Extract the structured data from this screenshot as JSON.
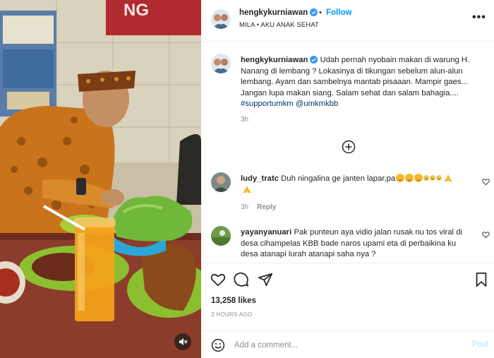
{
  "media": {
    "banner_text": "NG",
    "mute_icon": "speaker-muted-icon"
  },
  "header": {
    "username": "hengkykurniawan",
    "dot": "•",
    "follow_label": "Follow",
    "audio": "MILA • AKU ANAK SEHAT",
    "more": "•••"
  },
  "caption": {
    "username": "hengkykurniawan",
    "text": " Udah pernah nyobain makan di warung H. Nanang di lembang ? Lokasinya di tikungan sebelum alun-alun lembang. Ayam dan sambelnya mantab pisaaan. Mampir gaes... Jangan lupa makan siang. Salam sehat dan salam bahagia....",
    "tags": "#supportumkm @umkmkbb",
    "time": "3h"
  },
  "comments": [
    {
      "username": "ludy_tratc",
      "text": " Duh ningalina ge janten lapar,pa",
      "time": "3h",
      "reply_label": "Reply"
    },
    {
      "username": "yayanyanuari",
      "text": " Pak punteun aya vidio jalan rusak nu tos viral di desa cihampelas KBB bade naros upami eta di perbaikina ku desa atanapi lurah atanapi saha nya ?"
    }
  ],
  "engagement": {
    "likes": "13,258 likes",
    "date": "3 HOURS AGO"
  },
  "add_comment": {
    "placeholder": "Add a comment...",
    "post_label": "Post"
  },
  "colors": {
    "link": "#0095f6",
    "post_disabled": "#b2dffc",
    "muted": "#8e8e8e"
  }
}
